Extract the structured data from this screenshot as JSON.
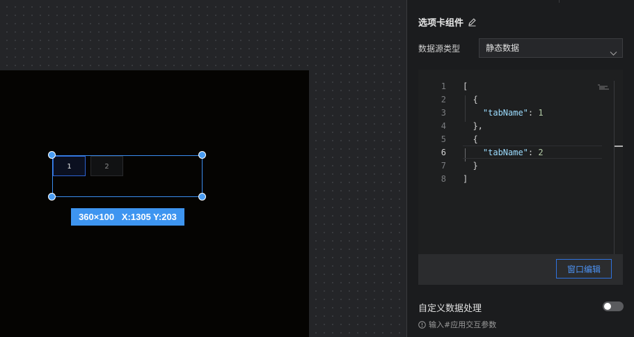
{
  "canvas": {
    "tabs": [
      {
        "label": "1",
        "active": true
      },
      {
        "label": "2",
        "active": false
      }
    ],
    "size_badge": "360×100   X:1305 Y:203"
  },
  "panel": {
    "title": "选项卡组件",
    "data_source_label": "数据源类型",
    "data_source_value": "静态数据",
    "editor": {
      "lines": [
        {
          "n": "1",
          "code": "["
        },
        {
          "n": "2",
          "code": "  {"
        },
        {
          "n": "3",
          "key": "    \"tabName\"",
          "sep": ": ",
          "num": "1"
        },
        {
          "n": "4",
          "code": "  },"
        },
        {
          "n": "5",
          "code": "  {"
        },
        {
          "n": "6",
          "key": "    \"tabName\"",
          "sep": ": ",
          "num": "2"
        },
        {
          "n": "7",
          "code": "  }"
        },
        {
          "n": "8",
          "code": "]"
        }
      ],
      "current_line": 6
    },
    "window_edit_button": "窗口编辑",
    "custom_processing_label": "自定义数据处理",
    "custom_processing_enabled": false,
    "hint": "输入#应用交互参数"
  },
  "colors": {
    "accent": "#3e95f0",
    "selection_border": "#3b8ef0",
    "json_key": "#9cdcfe",
    "json_number": "#b5cea8"
  }
}
